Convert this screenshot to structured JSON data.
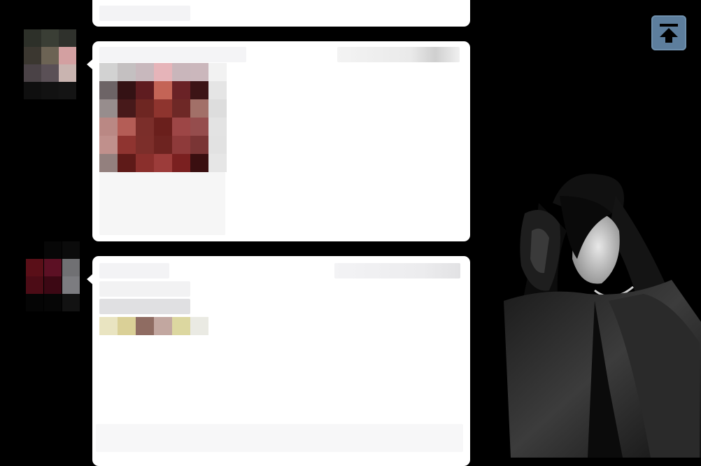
{
  "colors": {
    "background": "#000000",
    "card": "#ffffff",
    "scroll_button": "#5d7e9d"
  },
  "icons": {
    "scroll_top": "arrow-up-to-line-icon"
  },
  "avatars": {
    "post1": [
      "#2d3029",
      "#3a3e35",
      "#2f312c",
      "#3b3730",
      "#6c6354",
      "#d3a0a1",
      "#4a4246",
      "#5a5056",
      "#c9b4b0",
      "#0f0f0f",
      "#121212",
      "#141414"
    ],
    "post2": [
      "#000000",
      "#070707",
      "#0b0b0b",
      "#5a0f18",
      "#5c1024",
      "#707073",
      "#4c0c16",
      "#3c0814",
      "#7c7c80",
      "#050505",
      "#060606",
      "#121212"
    ]
  },
  "post1": {
    "image_pixels": [
      "#d2d2d2",
      "#c4c0c1",
      "#c8b8bd",
      "#e6b4b9",
      "#c9b6bb",
      "#cbb7bc",
      "#f2f2f2",
      "#6d6466",
      "#341214",
      "#5f1c20",
      "#c46456",
      "#6a2226",
      "#3c1416",
      "#e5e5e5",
      "#978d8d",
      "#47191a",
      "#6e2622",
      "#8e342e",
      "#6e2826",
      "#a27068",
      "#dddddd",
      "#ba8884",
      "#b45d56",
      "#7b2e2a",
      "#6a1f1c",
      "#9d4646",
      "#954d4d",
      "#e3e3e3",
      "#c0908c",
      "#8f3430",
      "#7c2e2a",
      "#6d2320",
      "#8e3a3a",
      "#7a3535",
      "#e2e2e2",
      "#93807e",
      "#5e1a18",
      "#8a2f2c",
      "#9c3c3a",
      "#7a2020",
      "#3a0f10",
      "#e6e6e6"
    ]
  },
  "post2": {
    "color_swatches": [
      "#e9e4c1",
      "#dad097",
      "#8f6c62",
      "#c2a7a0",
      "#dcd7a0",
      "#eaeae3"
    ]
  }
}
